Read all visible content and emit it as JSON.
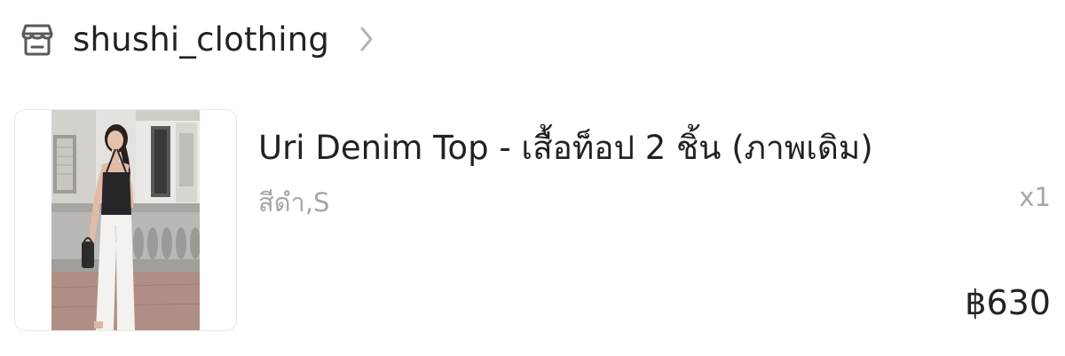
{
  "shop": {
    "name": "shushi_clothing",
    "icon": "store-icon",
    "chevron_icon": "chevron-right-icon"
  },
  "product": {
    "title": "Uri Denim Top - เสื้อท็อป 2 ชิ้น (ภาพเดิม)",
    "variant": "สีดำ,S",
    "quantity": "x1",
    "price": "฿630",
    "image": "product-photo"
  },
  "colors": {
    "text_primary": "#222222",
    "text_secondary": "#a6a6a6",
    "icon_gray": "#5a5a5a",
    "chevron_gray": "#b4b4b4"
  }
}
